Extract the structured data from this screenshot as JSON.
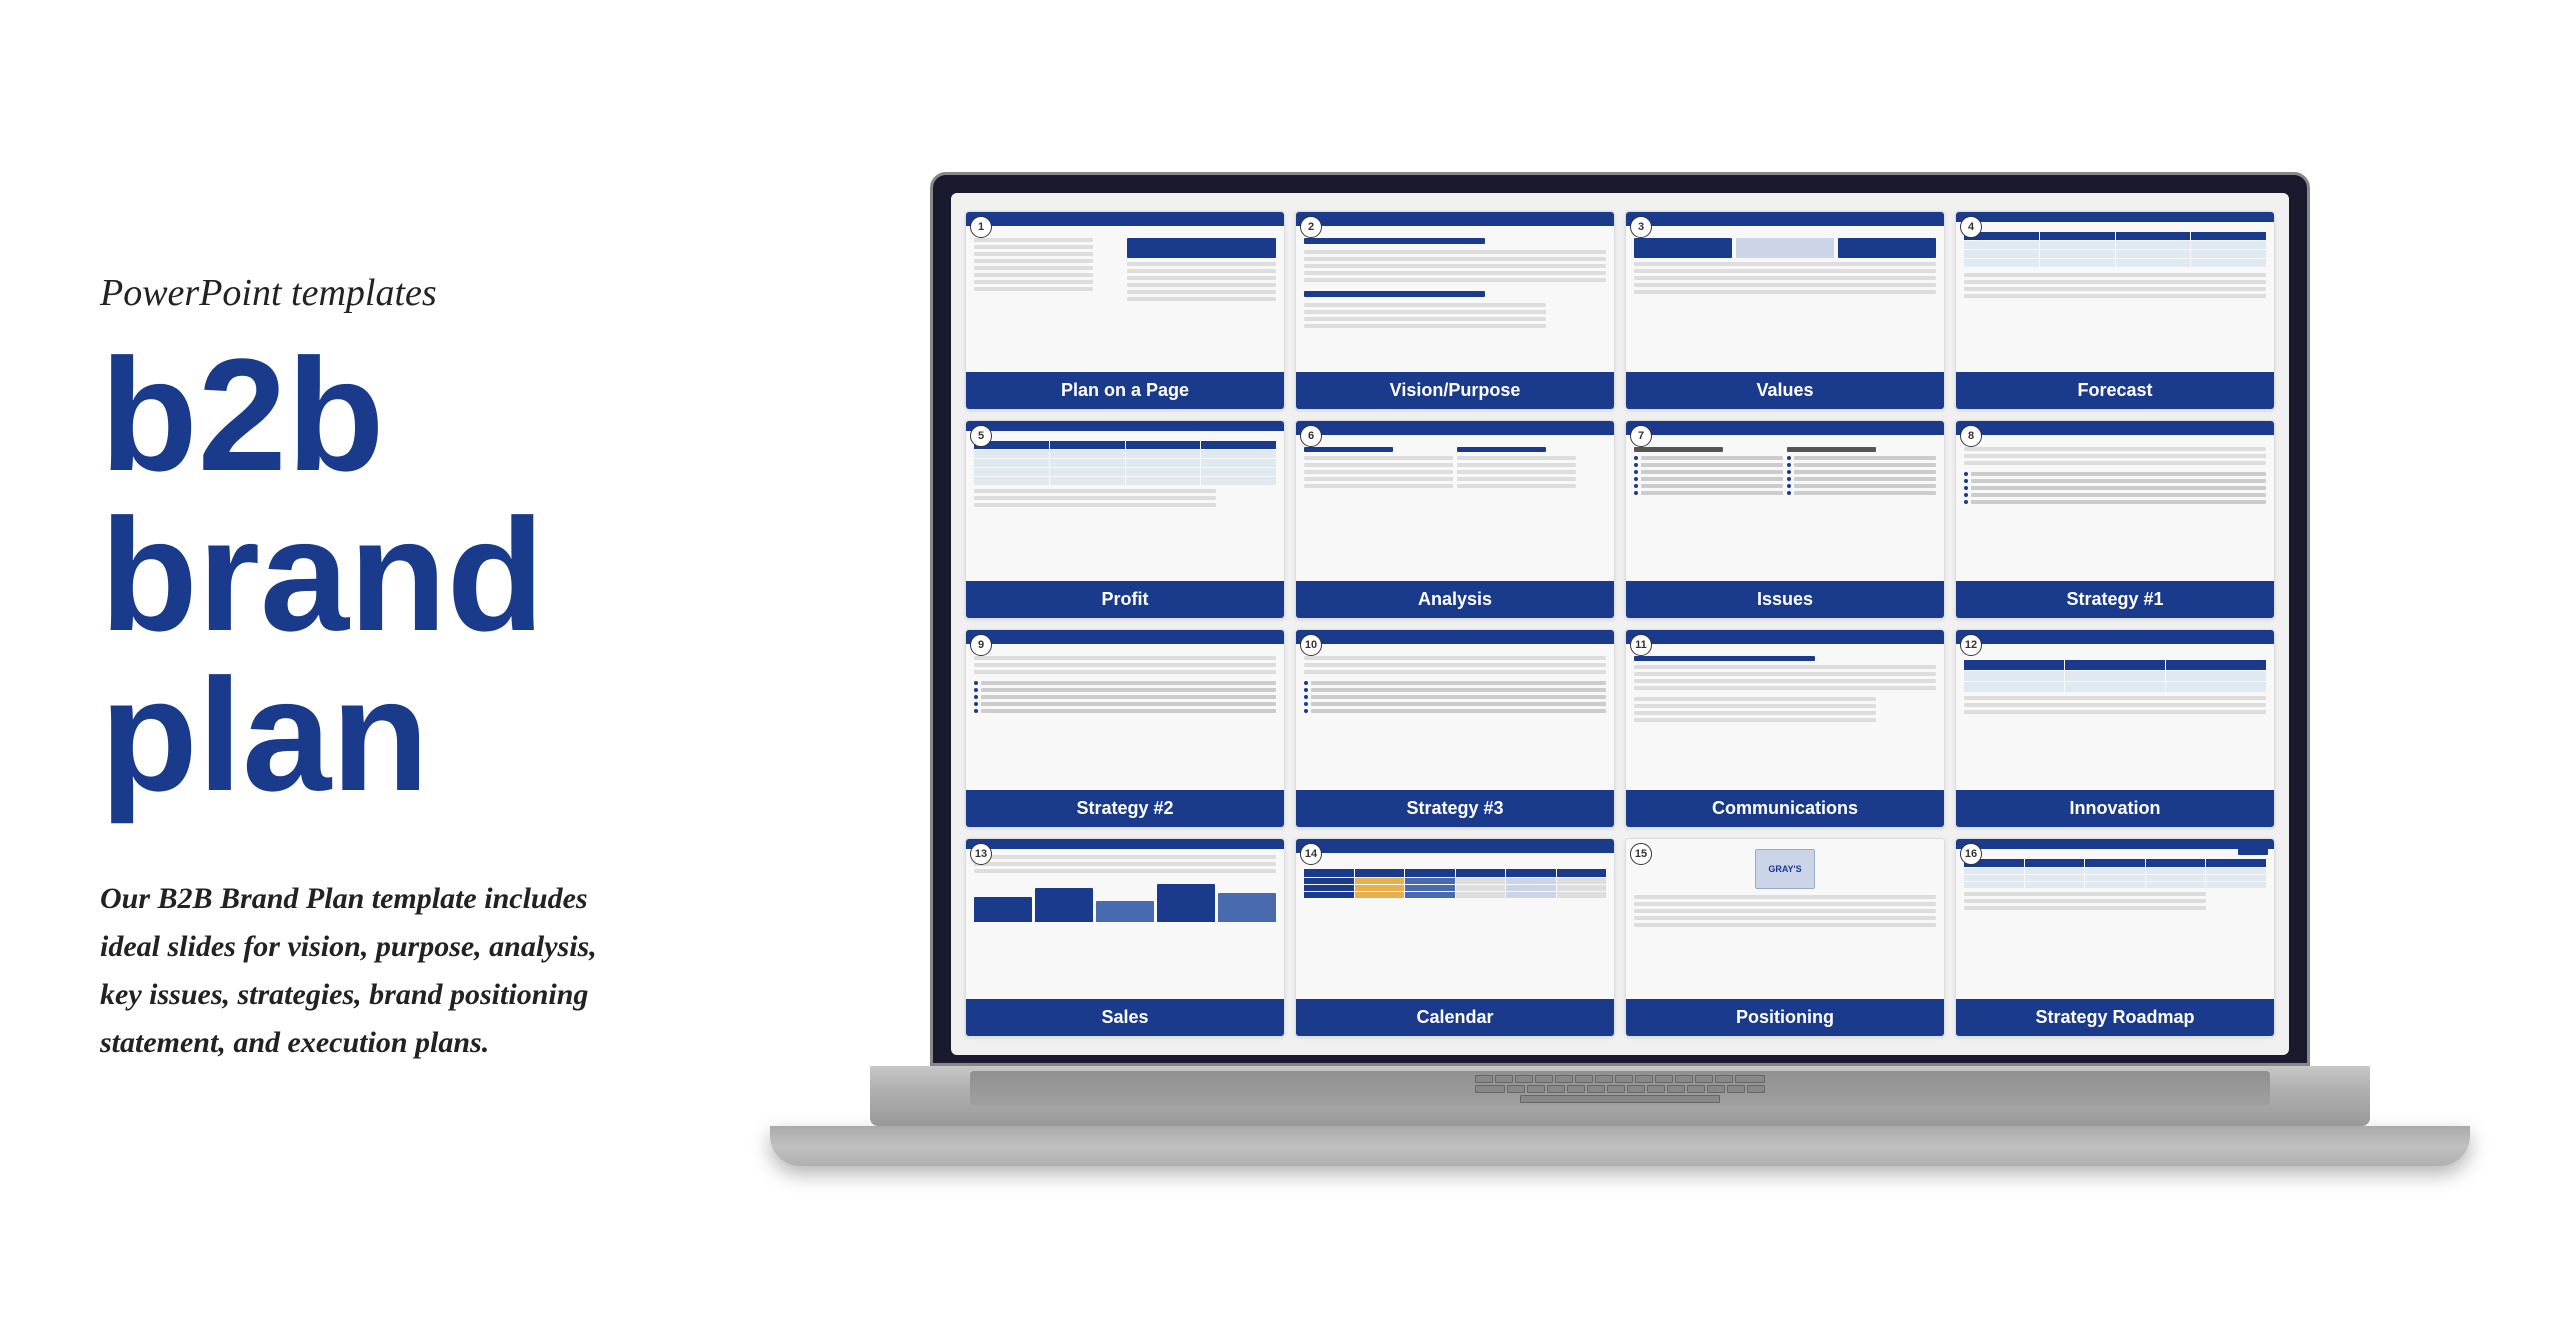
{
  "left": {
    "subtitle": "PowerPoint templates",
    "title": "b2b brand plan",
    "description": "Our B2B Brand Plan template includes ideal slides for vision, purpose, analysis, key issues, strategies, brand positioning statement, and execution plans."
  },
  "slides": [
    {
      "number": "1",
      "label": "Plan on a Page"
    },
    {
      "number": "2",
      "label": "Vision/Purpose"
    },
    {
      "number": "3",
      "label": "Values"
    },
    {
      "number": "4",
      "label": "Forecast"
    },
    {
      "number": "5",
      "label": "Profit"
    },
    {
      "number": "6",
      "label": "Analysis"
    },
    {
      "number": "7",
      "label": "Issues"
    },
    {
      "number": "8",
      "label": "Strategy #1"
    },
    {
      "number": "9",
      "label": "Strategy #2"
    },
    {
      "number": "10",
      "label": "Strategy #3"
    },
    {
      "number": "11",
      "label": "Communications"
    },
    {
      "number": "12",
      "label": "Innovation"
    },
    {
      "number": "13",
      "label": "Sales"
    },
    {
      "number": "14",
      "label": "Calendar"
    },
    {
      "number": "15",
      "label": "Positioning"
    },
    {
      "number": "16",
      "label": "Strategy Roadmap"
    }
  ]
}
